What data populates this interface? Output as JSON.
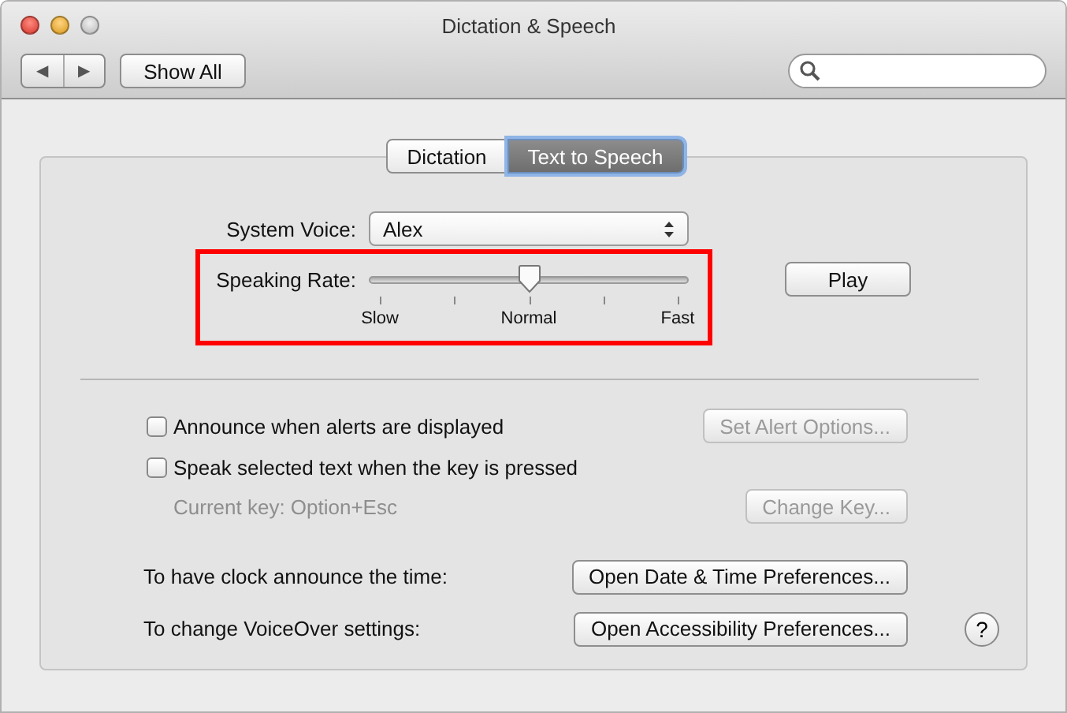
{
  "window": {
    "title": "Dictation & Speech"
  },
  "toolbar": {
    "back": "◀",
    "forward": "▶",
    "show_all": "Show All"
  },
  "tabs": [
    {
      "label": "Dictation",
      "selected": false
    },
    {
      "label": "Text to Speech",
      "selected": true
    }
  ],
  "system_voice": {
    "label": "System Voice:",
    "value": "Alex"
  },
  "speaking_rate": {
    "label": "Speaking Rate:",
    "level": 0.5,
    "scale_labels": [
      "Slow",
      "Normal",
      "Fast"
    ]
  },
  "play_button": {
    "label": "Play",
    "disabled": false
  },
  "options": [
    {
      "kind": "checkbox",
      "label": "Announce when alerts are displayed",
      "checked": false,
      "button": {
        "label": "Set Alert Options...",
        "disabled": true
      }
    },
    {
      "kind": "checkbox",
      "label": "Speak selected text when the key is pressed",
      "checked": false
    },
    {
      "kind": "note",
      "label": "Current key: Option+Esc",
      "disabled": true,
      "button": {
        "label": "Change Key...",
        "disabled": true
      }
    },
    {
      "kind": "link",
      "label": "To have clock announce the time:",
      "button": {
        "label": "Open Date & Time Preferences...",
        "disabled": false
      }
    },
    {
      "kind": "link",
      "label": "To change VoiceOver settings:",
      "button": {
        "label": "Open Accessibility Preferences...",
        "disabled": false
      },
      "help": "?"
    }
  ]
}
